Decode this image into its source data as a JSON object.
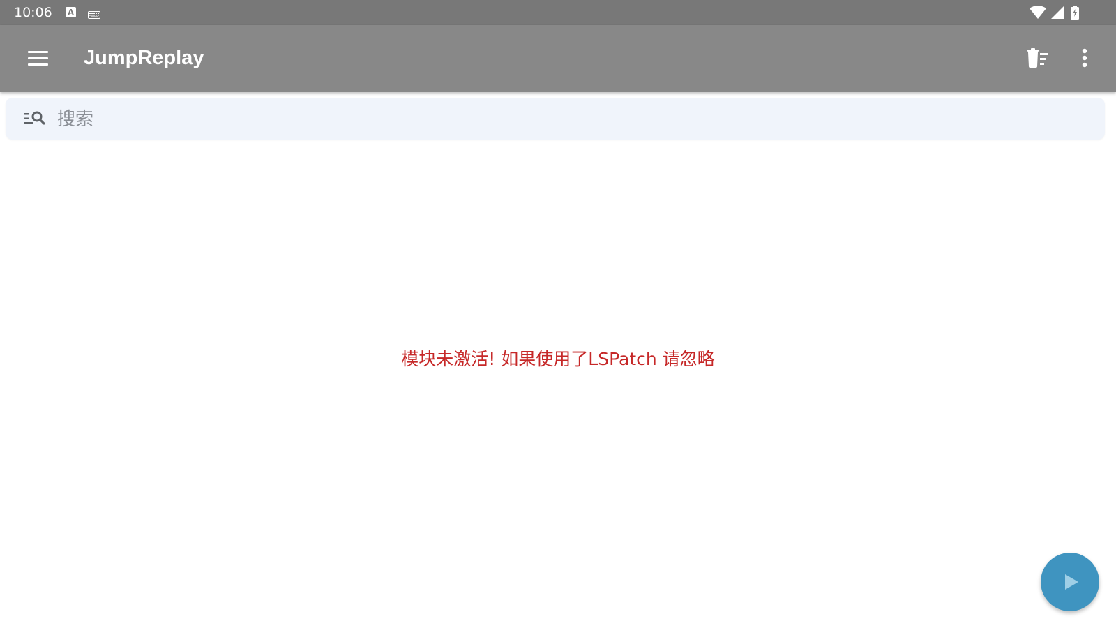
{
  "status_bar": {
    "time": "10:06",
    "notification_icon_letter": "A",
    "icons": [
      "text-notification-icon",
      "keyboard-icon",
      "wifi-icon",
      "signal-icon",
      "battery-charging-icon"
    ]
  },
  "app_bar": {
    "title": "JumpReplay",
    "background_color": "#888888",
    "icons": [
      "menu-icon",
      "clear-all-icon",
      "more-vert-icon"
    ]
  },
  "search": {
    "placeholder": "搜索",
    "value": ""
  },
  "message": {
    "text": "模块未激活! 如果使用了LSPatch 请忽略",
    "color": "#c62828"
  },
  "fab": {
    "icon": "play-icon",
    "color": "#3f94c0"
  }
}
